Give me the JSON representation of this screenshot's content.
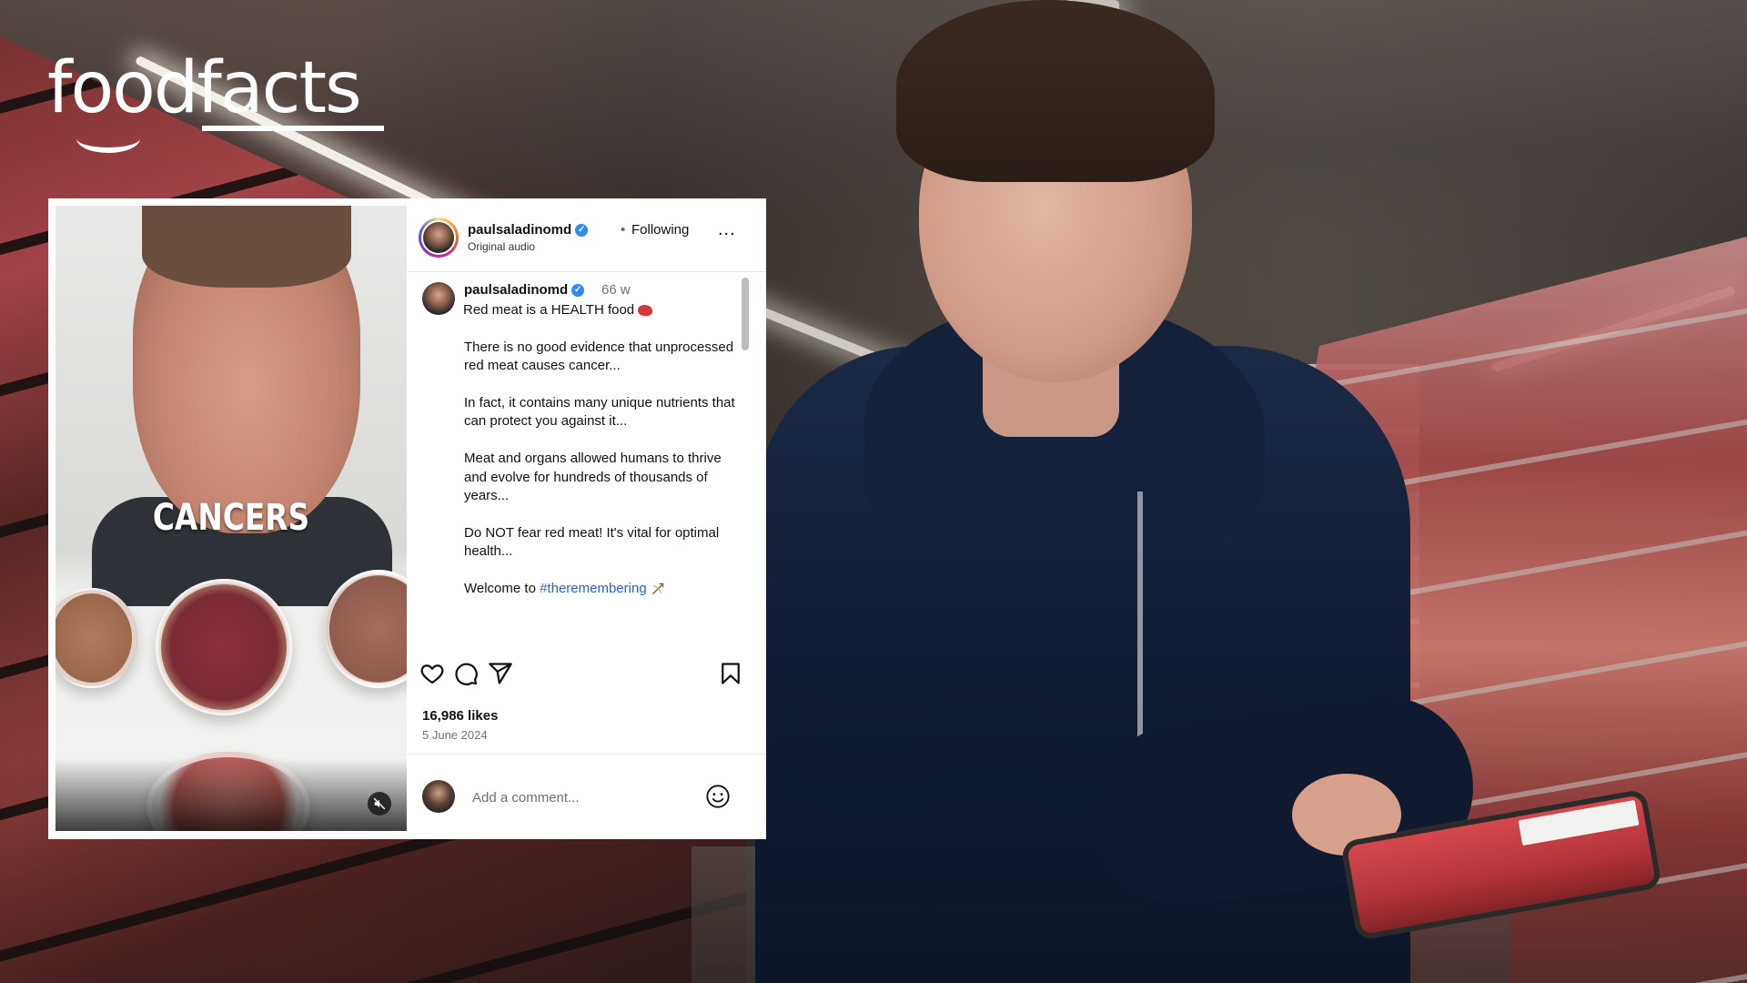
{
  "brand": {
    "logo_text": "foodfacts"
  },
  "video": {
    "caption_word": "CANCERS"
  },
  "post": {
    "header": {
      "username": "paulsaladinomd",
      "verified_mark": "✓",
      "dot": "•",
      "following_label": "Following",
      "audio_label": "Original audio",
      "more_label": "..."
    },
    "caption": {
      "username": "paulsaladinomd",
      "time_ago": "66 w",
      "line_1": "Red meat is a HEALTH food",
      "paragraph_1": "There is no good evidence that unprocessed red meat causes cancer...",
      "paragraph_2": "In fact, it contains many unique nutrients that can protect you against it...",
      "paragraph_3": "Meat and organs allowed humans to thrive and evolve for hundreds of thousands of years...",
      "paragraph_4": "Do NOT fear red meat! It's vital for optimal health...",
      "welcome_text": "Welcome to ",
      "hashtag": "#theremembering"
    },
    "likes": "16,986 likes",
    "date": "5 June 2024",
    "comment_box": {
      "placeholder": "Add a comment..."
    }
  },
  "icons": [
    "heart-icon",
    "comment-icon",
    "share-icon",
    "bookmark-icon",
    "emoji-icon",
    "mute-icon",
    "more-icon",
    "verified-badge"
  ]
}
